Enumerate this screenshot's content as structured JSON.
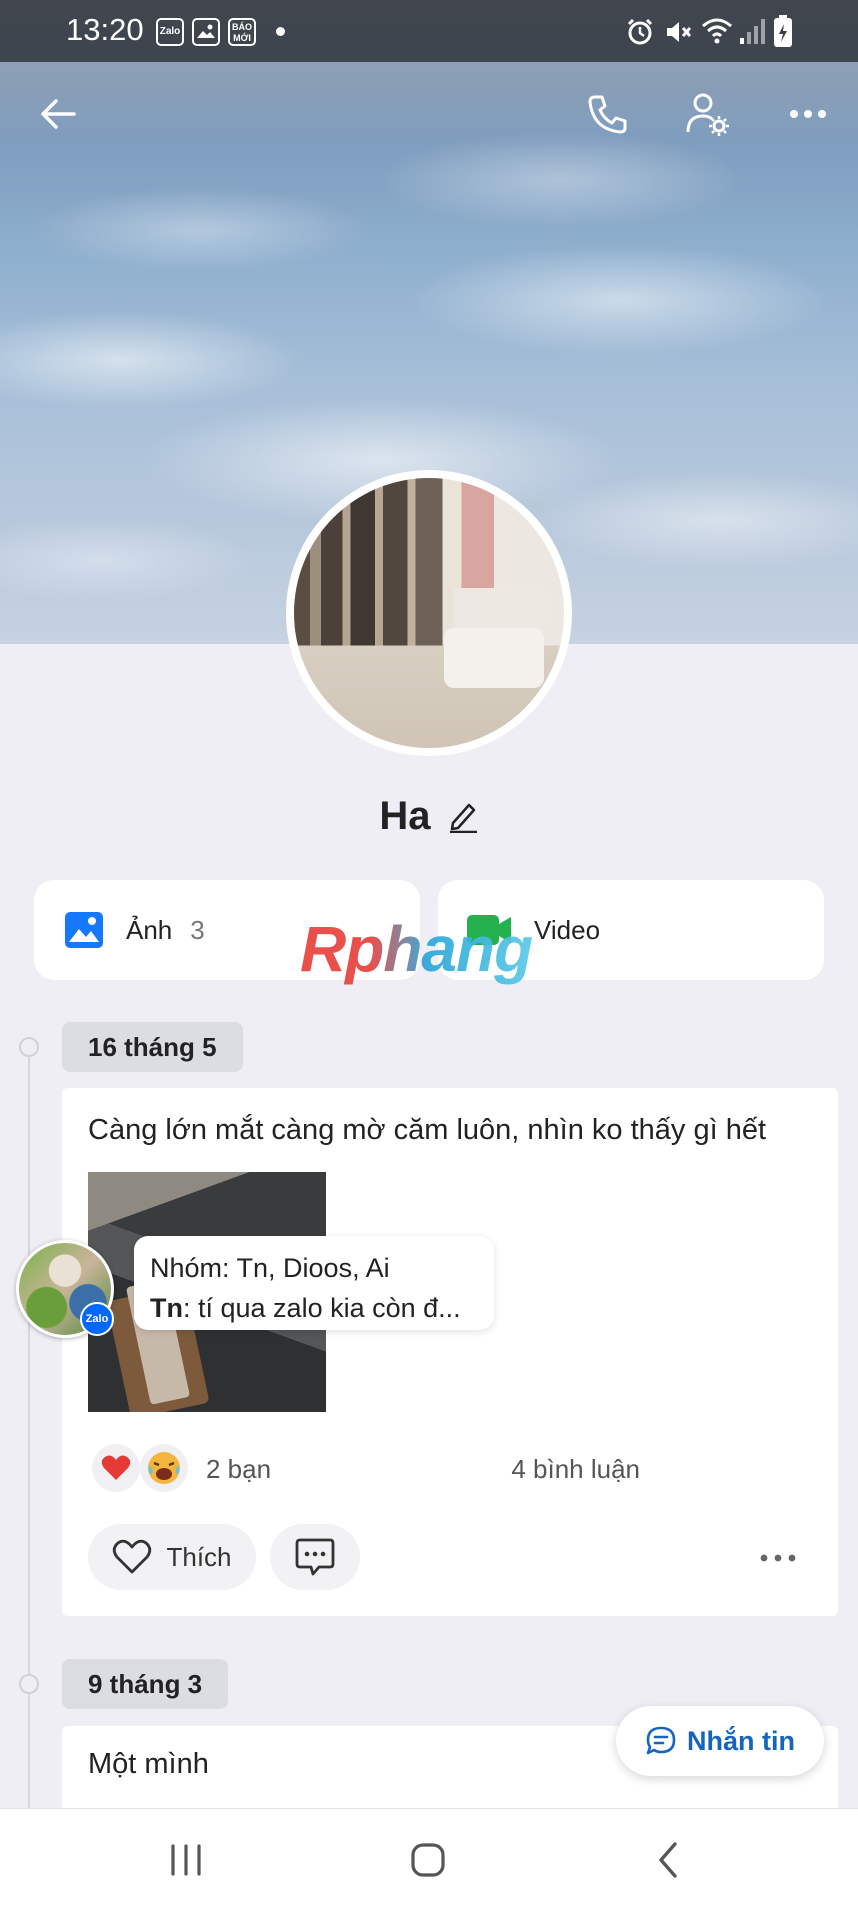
{
  "status_bar": {
    "time": "13:20",
    "notification_icons": [
      "zalo-icon",
      "gallery-icon",
      "baomoi-icon"
    ],
    "zalo_text": "Zalo",
    "baomoi_text": "BÁO MỚI",
    "system_icons": [
      "alarm-icon",
      "mute-icon",
      "wifi-icon",
      "signal-icon",
      "battery-icon"
    ]
  },
  "header": {
    "back_icon": "arrow-left-icon",
    "call_icon": "phone-icon",
    "settings_icon": "user-settings-icon",
    "more_icon": "more-horizontal-icon"
  },
  "profile": {
    "name": "Ha",
    "edit_icon": "pencil-icon"
  },
  "media": {
    "photos_label": "Ảnh",
    "photos_count": "3",
    "videos_label": "Video"
  },
  "watermark": "Rphang",
  "timeline": [
    {
      "date": "16 tháng 5",
      "text": "Càng lớn mắt càng mờ căm luôn, nhìn ko thấy gì hết",
      "reaction_count": "2 bạn",
      "comment_count": "4 bình luận",
      "like_label": "Thích"
    },
    {
      "date": "9 tháng 3",
      "text": "Một mình"
    }
  ],
  "chat_head": {
    "group_line": "Nhóm: Tn, Dioos, Ai",
    "sender": "Tn",
    "message": ": tí qua zalo kia còn đ...",
    "badge": "Zalo"
  },
  "fab": {
    "label": "Nhắn tin"
  },
  "colors": {
    "accent": "#1565c0",
    "photo_icon": "#1677ff",
    "video_icon": "#22b14c",
    "heart": "#e53935"
  }
}
